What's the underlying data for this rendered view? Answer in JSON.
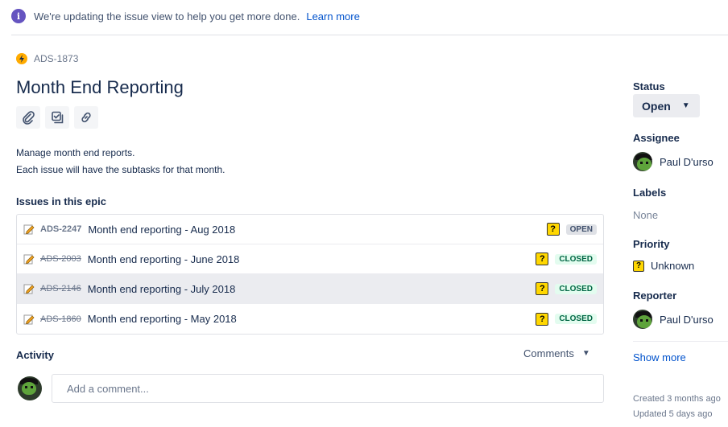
{
  "banner": {
    "message": "We're updating the issue view to help you get more done.",
    "link": "Learn more",
    "icon": "info-icon"
  },
  "issue": {
    "key": "ADS-1873",
    "title": "Month End Reporting",
    "description_lines": [
      "Manage month end reports.",
      "Each issue will have the subtasks for that month."
    ]
  },
  "toolbar": {
    "attach_icon": "paperclip-icon",
    "subtask_icon": "subtask-icon",
    "link_icon": "link-icon"
  },
  "epic": {
    "heading": "Issues in this epic",
    "issues": [
      {
        "key": "ADS-2247",
        "summary": "Month end reporting - Aug 2018",
        "status": "OPEN",
        "resolved": false,
        "priority_icon": "?"
      },
      {
        "key": "ADS-2003",
        "summary": "Month end reporting - June 2018",
        "status": "CLOSED",
        "resolved": true,
        "priority_icon": "?"
      },
      {
        "key": "ADS-2146",
        "summary": "Month end reporting - July 2018",
        "status": "CLOSED",
        "resolved": true,
        "priority_icon": "?"
      },
      {
        "key": "ADS-1860",
        "summary": "Month end reporting - May 2018",
        "status": "CLOSED",
        "resolved": true,
        "priority_icon": "?"
      }
    ]
  },
  "activity": {
    "heading": "Activity",
    "filter": "Comments",
    "comment_placeholder": "Add a comment..."
  },
  "sidebar": {
    "status_label": "Status",
    "status_value": "Open",
    "assignee_label": "Assignee",
    "assignee": "Paul D'urso",
    "labels_label": "Labels",
    "labels_value": "None",
    "priority_label": "Priority",
    "priority_value": "Unknown",
    "priority_icon": "?",
    "reporter_label": "Reporter",
    "reporter": "Paul D'urso",
    "show_more": "Show more",
    "created": "Created 3 months ago",
    "updated": "Updated 5 days ago"
  },
  "colors": {
    "accent": "#0052cc",
    "open_lozenge": "#dfe1e6",
    "closed_lozenge": "#e3fcef",
    "closed_text": "#006644",
    "epic_icon": "#ffab00"
  }
}
